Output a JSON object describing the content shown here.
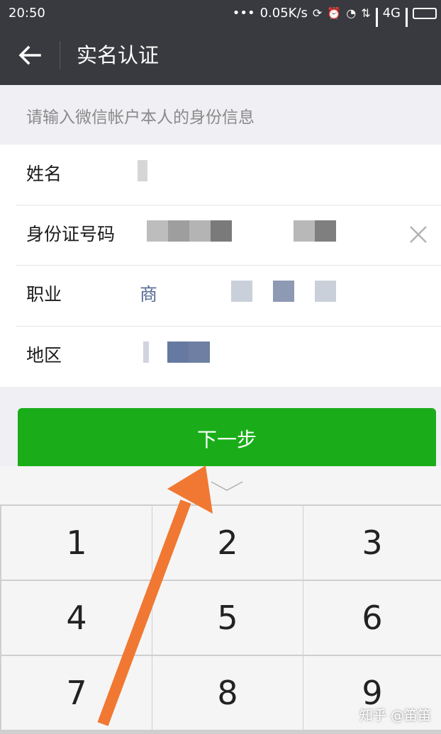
{
  "status_bar": {
    "time": "20:50",
    "speed": "0.05K/s",
    "network": "4G"
  },
  "nav": {
    "title": "实名认证"
  },
  "form": {
    "hint": "请输入微信帐户本人的身份信息",
    "rows": [
      {
        "label": "姓名",
        "value": ""
      },
      {
        "label": "身份证号码",
        "value": ""
      },
      {
        "label": "职业",
        "value": "商"
      },
      {
        "label": "地区",
        "value": ""
      }
    ]
  },
  "next_button": {
    "label": "下一步",
    "color": "#1aad19"
  },
  "keyboard": {
    "keys": [
      "1",
      "2",
      "3",
      "4",
      "5",
      "6",
      "7",
      "8",
      "9"
    ]
  },
  "watermark": "知乎 @笛笛",
  "colors": {
    "header": "#393a3f",
    "arrow": "#f07832"
  }
}
